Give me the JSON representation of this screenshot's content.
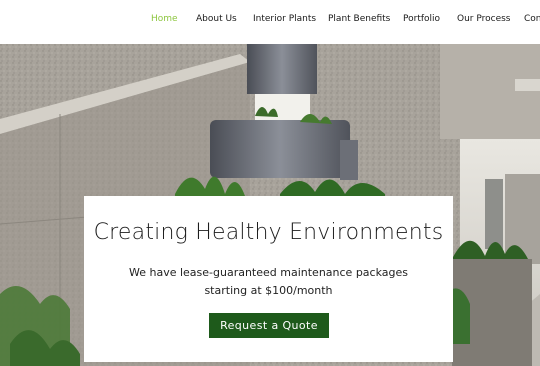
{
  "nav": {
    "items": [
      "Home",
      "About Us",
      "Interior Plants",
      "Plant Benefits",
      "Portfolio",
      "Our Process",
      "Con"
    ],
    "active_color": "#8dc63f",
    "text_color": "#1a1a1a"
  },
  "hero": {
    "title": "Creating Healthy Environments",
    "subtitle": "We have lease-guaranteed maintenance packages starting at $100/month",
    "cta_label": "Request a Quote",
    "cta_color": "#1e5a1b"
  }
}
